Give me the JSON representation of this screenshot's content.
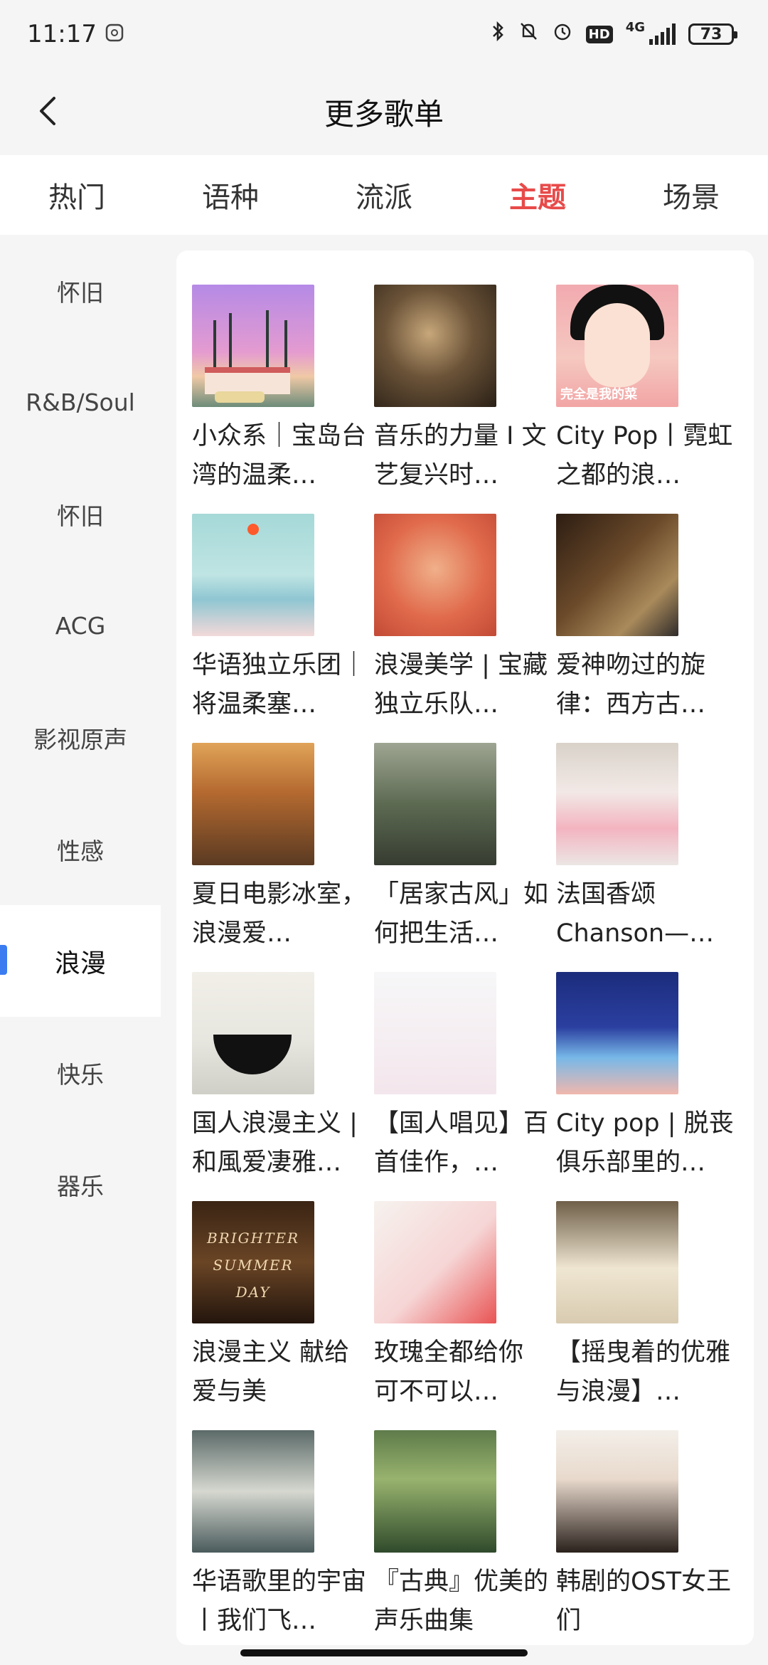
{
  "status_bar": {
    "time": "11:17",
    "network": "4G",
    "hd_badge": "HD",
    "battery": "73"
  },
  "header": {
    "title": "更多歌单"
  },
  "tabs": [
    {
      "label": "热门",
      "active": false
    },
    {
      "label": "语种",
      "active": false
    },
    {
      "label": "流派",
      "active": false
    },
    {
      "label": "主题",
      "active": true
    },
    {
      "label": "场景",
      "active": false
    }
  ],
  "sidebar": {
    "items": [
      {
        "label": "怀旧"
      },
      {
        "label": "R&B/Soul"
      },
      {
        "label": "怀旧"
      },
      {
        "label": "ACG"
      },
      {
        "label": "影视原声"
      },
      {
        "label": "性感"
      },
      {
        "label": "浪漫",
        "active": true
      },
      {
        "label": "快乐"
      },
      {
        "label": "器乐"
      }
    ]
  },
  "playlists": [
    {
      "title": "小众系｜宝岛台湾的温柔…"
    },
    {
      "title": "音乐的力量 I 文艺复兴时…"
    },
    {
      "title": "City Pop丨霓虹之都的浪…"
    },
    {
      "title": "华语独立乐团｜将温柔塞…"
    },
    {
      "title": "浪漫美学 | 宝藏独立乐队…"
    },
    {
      "title": "爱神吻过的旋律：西方古…"
    },
    {
      "title": "夏日电影冰室，浪漫爱…"
    },
    {
      "title": "「居家古风」如何把生活…"
    },
    {
      "title": "法国香颂Chanson——永…"
    },
    {
      "title": "国人浪漫主义 | 和風爱凄雅…"
    },
    {
      "title": "【国人唱见】百首佳作，…"
    },
    {
      "title": "City pop | 脱丧俱乐部里的…"
    },
    {
      "title": "浪漫主义 献给爱与美"
    },
    {
      "title": "玫瑰全都给你 可不可以…"
    },
    {
      "title": "【摇曳着的优雅与浪漫】…"
    },
    {
      "title": "华语歌里的宇宙丨我们飞…"
    },
    {
      "title": "『古典』优美的声乐曲集"
    },
    {
      "title": "韩剧的OST女王们"
    }
  ],
  "cover_text": {
    "c3": "完全是我的菜",
    "c13_line1": "BRIGHTER",
    "c13_line2": "SUMMER",
    "c13_line3": "DAY"
  },
  "colors": {
    "active_tab": "#e84a4a",
    "sidebar_indicator": "#3b7cf0"
  }
}
